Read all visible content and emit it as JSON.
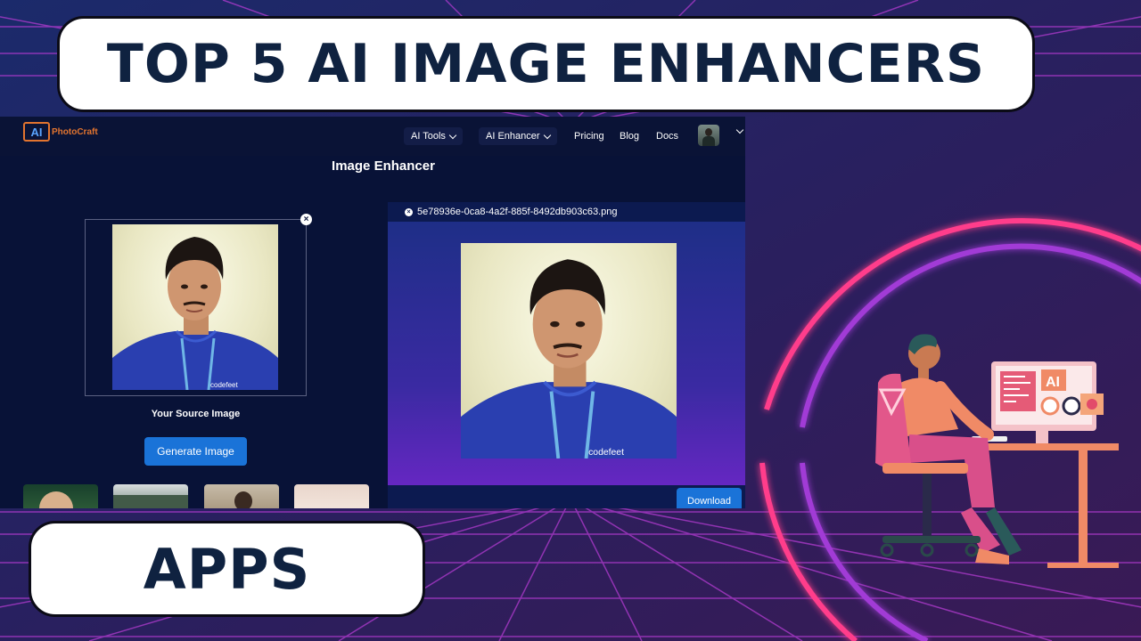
{
  "title": "TOP 5 AI IMAGE ENHANCERS",
  "subtitle": "APPS",
  "app": {
    "logo": {
      "mark": "AI",
      "name": "PhotoCraft"
    },
    "nav": {
      "ai_tools": "AI Tools",
      "ai_enhancer": "AI Enhancer",
      "pricing": "Pricing",
      "blog": "Blog",
      "docs": "Docs"
    },
    "page_title": "Image Enhancer",
    "source_caption": "Your Source Image",
    "generate_label": "Generate Image",
    "result_filename": "5e78936e-0ca8-4a2f-885f-8492db903c63.png",
    "download_label": "Download",
    "close_glyph": "×",
    "shirt_text": "codefeet"
  },
  "illustration": {
    "screen_text": "AI"
  },
  "colors": {
    "accent_blue": "#1a73d8",
    "banner_text": "#0f2240",
    "neon_pink": "#ff3d8b",
    "neon_purple": "#a13bd6"
  }
}
